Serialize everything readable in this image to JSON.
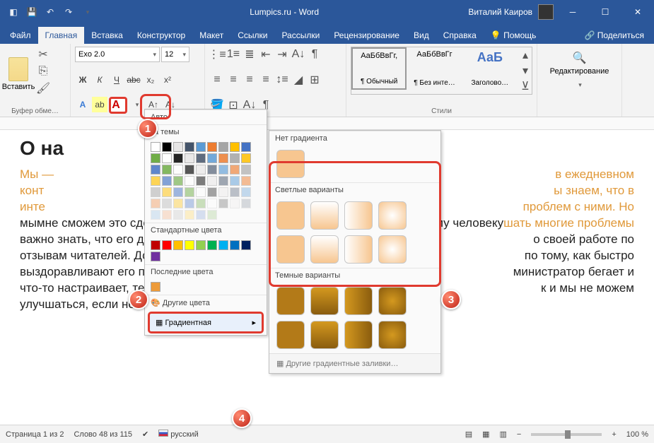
{
  "title": "Lumpics.ru - Word",
  "user": "Виталий Каиров",
  "menu": {
    "file": "Файл",
    "home": "Главная",
    "insert": "Вставка",
    "design": "Конструктор",
    "layout": "Макет",
    "refs": "Ссылки",
    "mail": "Рассылки",
    "review": "Рецензирование",
    "view": "Вид",
    "help": "Справка",
    "tell": "Помощь",
    "share": "Поделиться"
  },
  "ribbon": {
    "clipboard": "Буфер обме…",
    "paste": "Вставить",
    "font_name": "Exo 2.0",
    "font_size": "12",
    "styles_label": "Стили",
    "style1": {
      "preview": "АаБбВвГг,",
      "name": "¶ Обычный"
    },
    "style2": {
      "preview": "АаБбВвГг",
      "name": "¶ Без инте…"
    },
    "style3": {
      "preview": "АаБ",
      "name": "Заголово…"
    },
    "edit": "Редактирование"
  },
  "colorpanel": {
    "auto": "Авто",
    "theme": "та темы",
    "standard": "Стандартные цвета",
    "recent": "Последние цвета",
    "more": "Другие цвета",
    "gradient": "Градиентная",
    "theme_colors": [
      "#ffffff",
      "#000000",
      "#e7e6e6",
      "#44546a",
      "#5b9bd5",
      "#ed7d31",
      "#a5a5a5",
      "#ffc000",
      "#4472c4",
      "#70ad47"
    ],
    "std_colors": [
      "#c00000",
      "#ff0000",
      "#ffc000",
      "#ffff00",
      "#92d050",
      "#00b050",
      "#00b0f0",
      "#0070c0",
      "#002060",
      "#7030a0"
    ],
    "recent_colors": [
      "#ed9b3a"
    ]
  },
  "gradientpanel": {
    "none": "Нет градиента",
    "light": "Светлые варианты",
    "dark": "Темные варианты",
    "more": "Другие градиентные заливки…"
  },
  "doc": {
    "heading": "О на",
    "p1": "Мы —",
    "p1b": "в ежедневном",
    "p2": "конт",
    "p2b": "ы знаем, что в",
    "p3": "инте",
    "p3b": "проблем с ними. Но",
    "p4": "",
    "p4b": "шать многие проблемы",
    "b1": "мымне сможем это сдел",
    "b1r": "юбому человеку",
    "b2": "важно знать, что его дейст",
    "b2r": "о своей работе по",
    "b3": "отзывам читателей. Докто",
    "b3r": "по тому, как быстро",
    "b4": "выздоравливают его пацие",
    "b4r": "министратор бегает и",
    "b5": "что-то настраивает, тем от",
    "b5r": "к и мы не можем",
    "b6": "улучшаться, если не бу"
  },
  "status": {
    "page": "Страница 1 из 2",
    "words": "Слово 48 из 115",
    "lang": "русский",
    "zoom": "100 %"
  },
  "badges": {
    "1": "1",
    "2": "2",
    "3": "3",
    "4": "4"
  }
}
